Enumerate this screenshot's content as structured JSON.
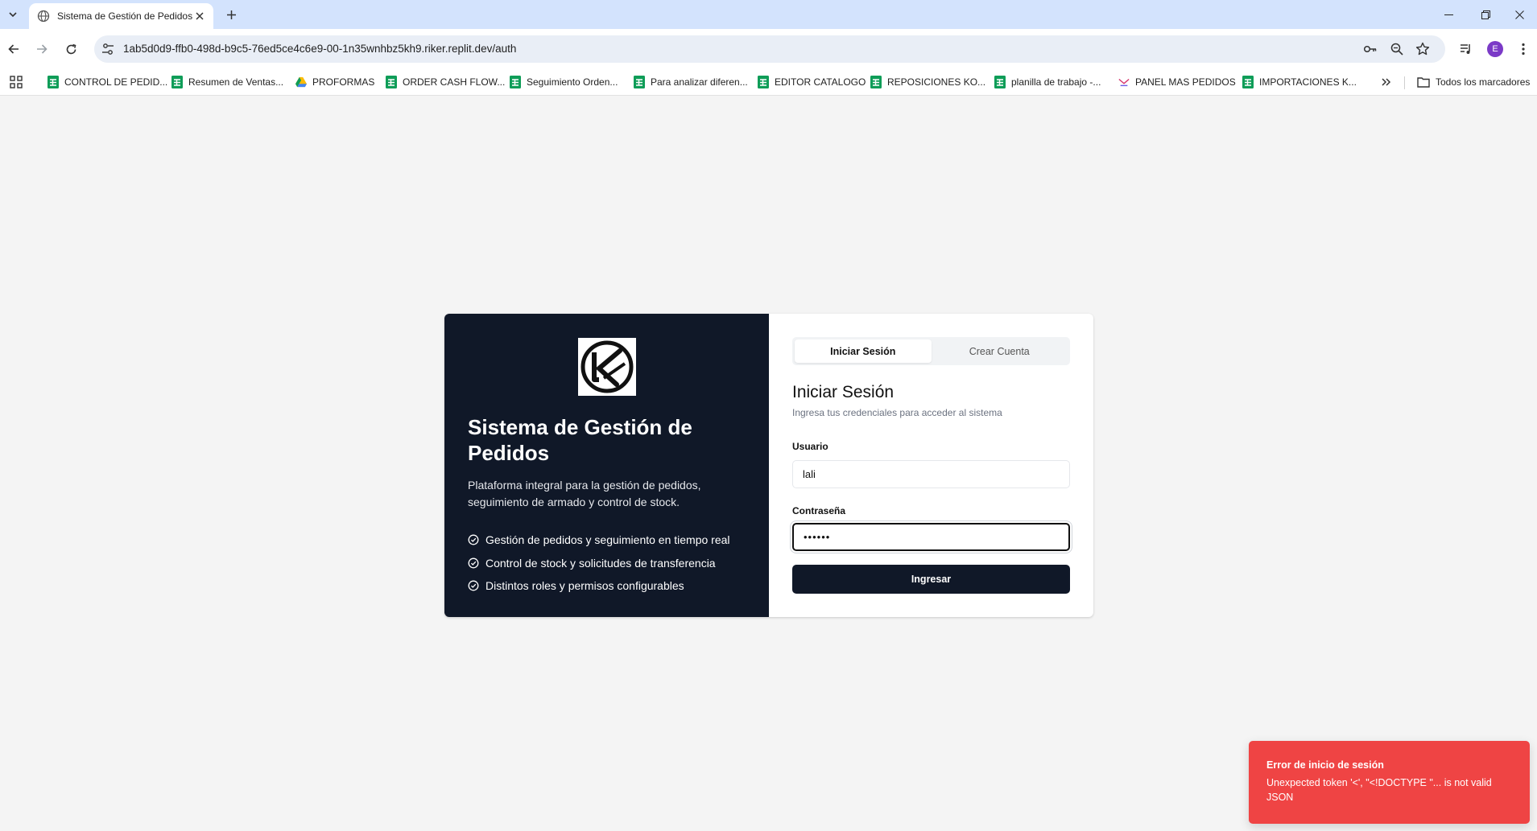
{
  "browser": {
    "tab_title": "Sistema de Gestión de Pedidos",
    "url": "1ab5d0d9-ffb0-498d-b9c5-76ed5ce4c6e9-00-1n35wnhbz5kh9.riker.replit.dev/auth",
    "profile_initial": "E",
    "bookmarks": [
      {
        "label": "CONTROL DE PEDID...",
        "icon": "sheets-icon"
      },
      {
        "label": "Resumen de Ventas...",
        "icon": "sheets-icon"
      },
      {
        "label": "PROFORMAS",
        "icon": "drive-icon"
      },
      {
        "label": "ORDER CASH FLOW...",
        "icon": "sheets-icon"
      },
      {
        "label": "Seguimiento Orden...",
        "icon": "sheets-icon"
      },
      {
        "label": "Para analizar diferen...",
        "icon": "sheets-icon"
      },
      {
        "label": "EDITOR CATALOGO",
        "icon": "sheets-icon"
      },
      {
        "label": "REPOSICIONES KO...",
        "icon": "sheets-icon"
      },
      {
        "label": "planilla de trabajo -...",
        "icon": "sheets-icon"
      },
      {
        "label": "PANEL MAS PEDIDOS",
        "icon": "app-icon"
      },
      {
        "label": "IMPORTACIONES K...",
        "icon": "sheets-icon"
      }
    ],
    "all_bookmarks_label": "Todos los marcadores"
  },
  "hero": {
    "title": "Sistema de Gestión de Pedidos",
    "description": "Plataforma integral para la gestión de pedidos, seguimiento de armado y control de stock.",
    "features": [
      "Gestión de pedidos y seguimiento en tiempo real",
      "Control de stock y solicitudes de transferencia",
      "Distintos roles y permisos configurables"
    ]
  },
  "auth": {
    "tabs": {
      "login": "Iniciar Sesión",
      "register": "Crear Cuenta"
    },
    "heading": "Iniciar Sesión",
    "subheading": "Ingresa tus credenciales para acceder al sistema",
    "username_label": "Usuario",
    "username_value": "lali",
    "password_label": "Contraseña",
    "password_mask": "••••••",
    "submit_label": "Ingresar"
  },
  "toast": {
    "title": "Error de inicio de sesión",
    "message": "Unexpected token '<', \"<!DOCTYPE \"... is not valid JSON"
  },
  "colors": {
    "hero_bg": "#101828",
    "toast_bg": "#ef4444",
    "tabbar_bg": "#d3e3fd"
  }
}
